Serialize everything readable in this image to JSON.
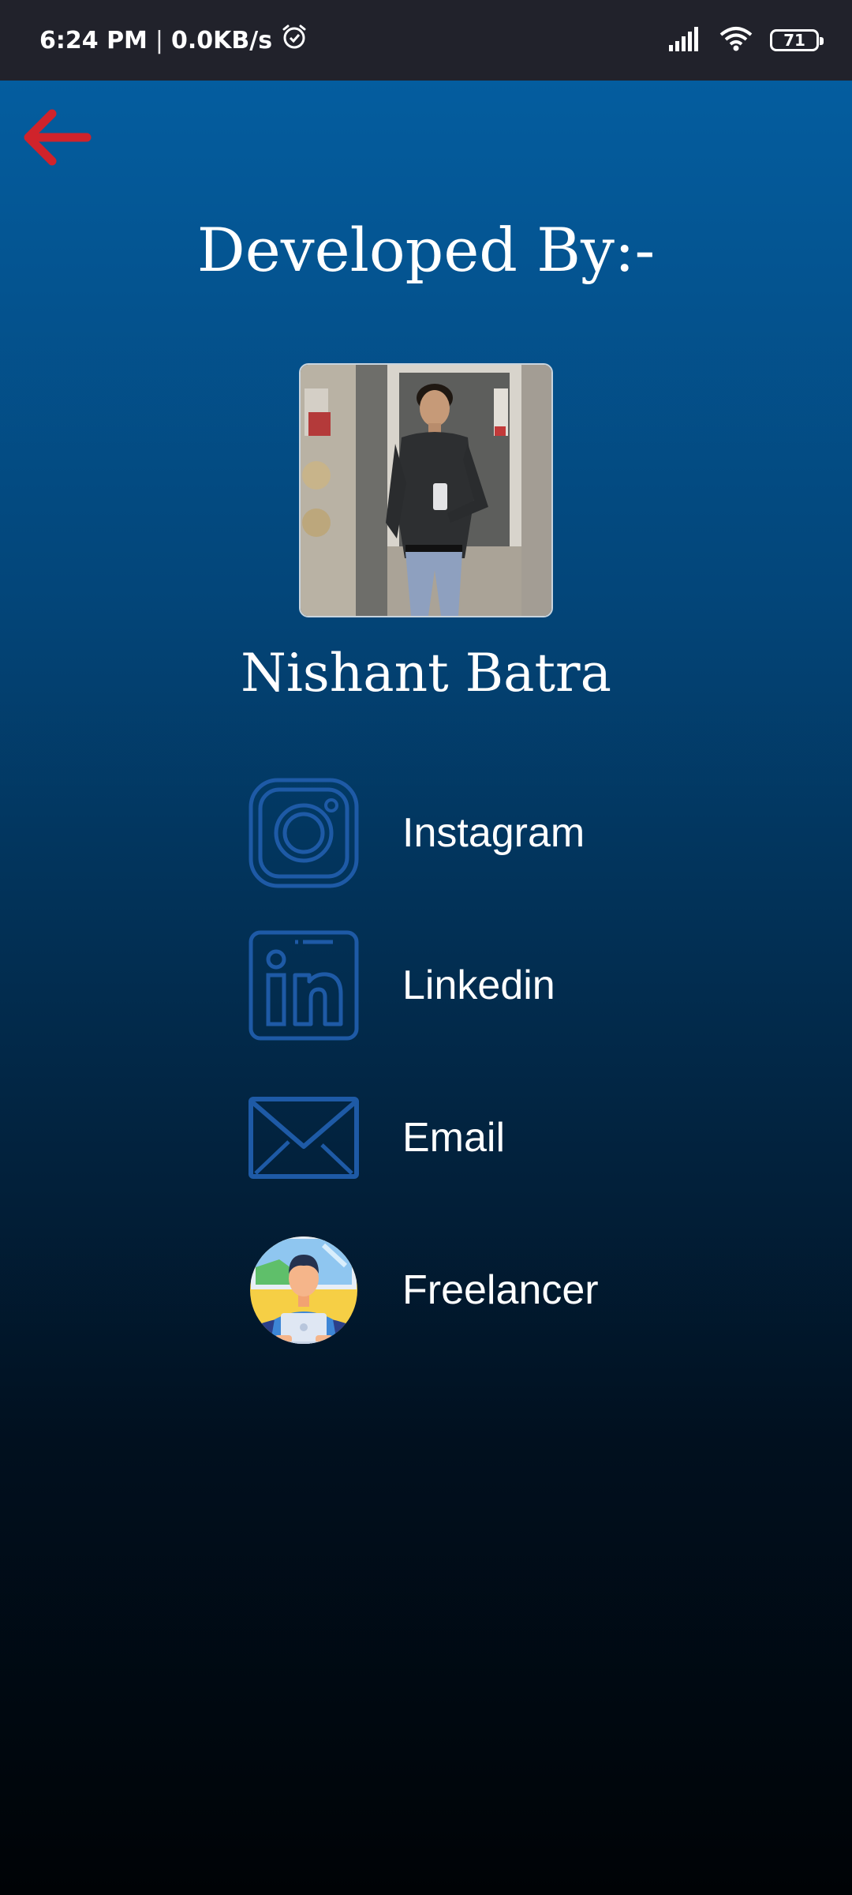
{
  "status_bar": {
    "time": "6:24 PM",
    "separator": "|",
    "net_speed": "0.0KB/s",
    "battery": "71",
    "icons": [
      "alarm-icon",
      "signal-icon",
      "wifi-icon",
      "battery-icon"
    ]
  },
  "page": {
    "title": "Developed By:-",
    "developer_name": "Nishant Batra"
  },
  "links": [
    {
      "icon": "instagram-icon",
      "label": "Instagram"
    },
    {
      "icon": "linkedin-icon",
      "label": "Linkedin"
    },
    {
      "icon": "email-icon",
      "label": "Email"
    },
    {
      "icon": "freelancer-icon",
      "label": "Freelancer"
    }
  ],
  "colors": {
    "back_arrow": "#d0232b",
    "icon_stroke": "#1e5aa6",
    "status_bar_bg": "#21222b",
    "gradient_top": "#045d9f",
    "gradient_bottom": "#000306"
  }
}
